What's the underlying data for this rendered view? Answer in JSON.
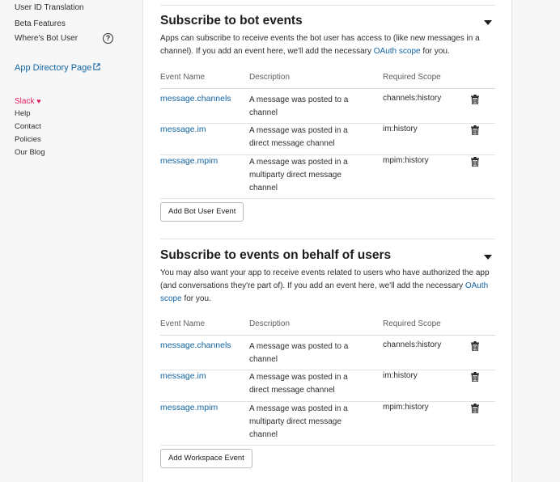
{
  "sidebar": {
    "items": [
      {
        "label": "User ID Translation"
      },
      {
        "label": "Beta Features"
      },
      {
        "label": "Where's Bot User"
      }
    ],
    "help_icon_glyph": "?",
    "app_directory": "App Directory Page",
    "footer": {
      "slack": "Slack",
      "heart": "♥",
      "links": [
        "Help",
        "Contact",
        "Policies",
        "Our Blog"
      ]
    }
  },
  "bot_events": {
    "title": "Subscribe to bot events",
    "desc_part1": "Apps can subscribe to receive events the bot user has access to (like new messages in a channel). If you add an event here, we'll add the necessary ",
    "desc_link": "OAuth scope",
    "desc_part2": " for you.",
    "columns": [
      "Event Name",
      "Description",
      "Required Scope"
    ],
    "rows": [
      {
        "name": "message.channels",
        "desc": "A message was posted to a channel",
        "scope": "channels:history"
      },
      {
        "name": "message.im",
        "desc": "A message was posted in a direct message channel",
        "scope": "im:history"
      },
      {
        "name": "message.mpim",
        "desc": "A message was posted in a multiparty direct message channel",
        "scope": "mpim:history"
      }
    ],
    "button": "Add Bot User Event"
  },
  "user_events": {
    "title": "Subscribe to events on behalf of users",
    "desc_part1": "You may also want your app to receive events related to users who have authorized the app (and conversations they're part of). If you add an event here, we'll add the necessary ",
    "desc_link": "OAuth scope",
    "desc_part2": " for you.",
    "columns": [
      "Event Name",
      "Description",
      "Required Scope"
    ],
    "rows": [
      {
        "name": "message.channels",
        "desc": "A message was posted to a channel",
        "scope": "channels:history"
      },
      {
        "name": "message.im",
        "desc": "A message was posted in a direct message channel",
        "scope": "im:history"
      },
      {
        "name": "message.mpim",
        "desc": "A message was posted in a multiparty direct message channel",
        "scope": "mpim:history"
      }
    ],
    "button": "Add Workspace Event"
  },
  "colors": {
    "link": "#1264a3",
    "heart": "#e01e5a",
    "background": "#f7f7f7"
  }
}
